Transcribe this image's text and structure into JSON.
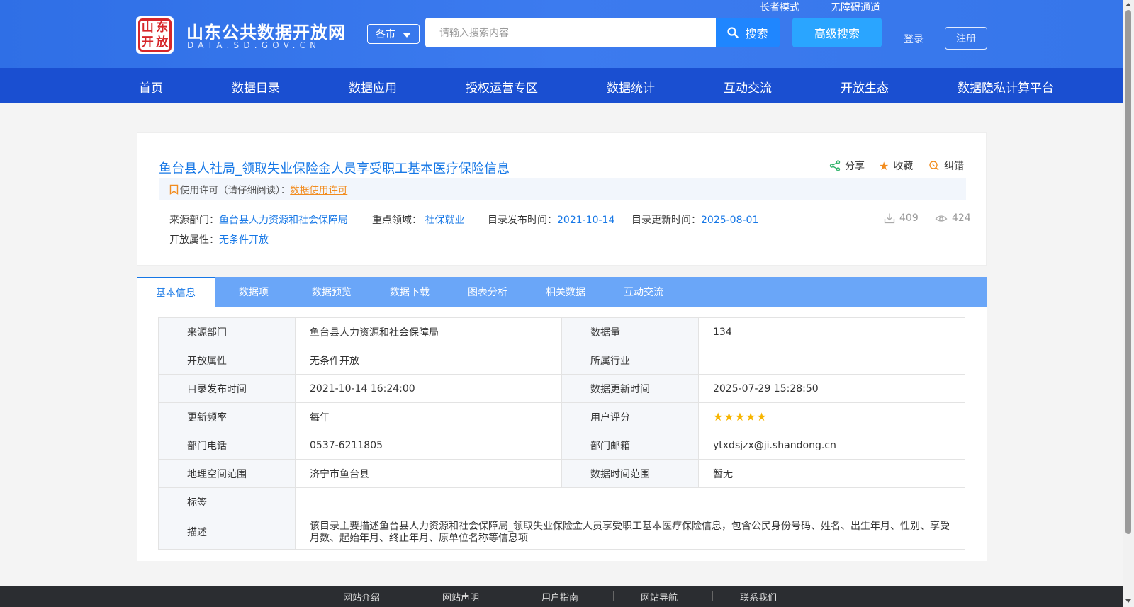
{
  "header": {
    "site_title": "山东公共数据开放网",
    "site_subtitle": "DATA.SD.GOV.CN",
    "seal_chars": [
      "山",
      "东",
      "开",
      "放"
    ],
    "city_select": "各市",
    "search_placeholder": "请输入搜索内容",
    "search_button": "搜索",
    "advanced_search": "高级搜索",
    "elder_mode": "长者模式",
    "accessibility": "无障碍通道",
    "login": "登录",
    "register": "注册"
  },
  "nav": [
    "首页",
    "数据目录",
    "数据应用",
    "授权运营专区",
    "数据统计",
    "互动交流",
    "开放生态",
    "数据隐私计算平台"
  ],
  "dataset": {
    "title": "鱼台县人社局_领取失业保险金人员享受职工基本医疗保险信息",
    "actions": {
      "share": "分享",
      "favorite": "收藏",
      "correct": "纠错"
    },
    "license_label": "使用许可（请仔细阅读）：",
    "license_link": "数据使用许可",
    "meta": {
      "source_label": "来源部门：",
      "source": "鱼台县人力资源和社会保障局",
      "domain_label": "重点领域：",
      "domain": "社保就业",
      "published_label": "目录发布时间：",
      "published": "2021-10-14",
      "updated_label": "目录更新时间：",
      "updated": "2025-08-01",
      "open_label": "开放属性：",
      "open": "无条件开放"
    },
    "downloads": "409",
    "views": "424"
  },
  "tabs": [
    "基本信息",
    "数据项",
    "数据预览",
    "数据下载",
    "图表分析",
    "相关数据",
    "互动交流"
  ],
  "info": {
    "r1": {
      "l1": "来源部门",
      "v1": "鱼台县人力资源和社会保障局",
      "l2": "数据量",
      "v2": "134"
    },
    "r2": {
      "l1": "开放属性",
      "v1": "无条件开放",
      "l2": "所属行业",
      "v2": ""
    },
    "r3": {
      "l1": "目录发布时间",
      "v1": "2021-10-14 16:24:00",
      "l2": "数据更新时间",
      "v2": "2025-07-29 15:28:50"
    },
    "r4": {
      "l1": "更新频率",
      "v1": "每年",
      "l2": "用户评分",
      "rating": 5
    },
    "r5": {
      "l1": "部门电话",
      "v1": "0537-6211805",
      "l2": "部门邮箱",
      "v2": "ytxdsjzx@ji.shandong.cn"
    },
    "r6": {
      "l1": "地理空间范围",
      "v1": "济宁市鱼台县",
      "l2": "数据时间范围",
      "v2": "暂无"
    },
    "r7": {
      "l1": "标签",
      "v1": ""
    },
    "r8": {
      "l1": "描述",
      "v1": "该目录主要描述鱼台县人力资源和社会保障局_领取失业保险金人员享受职工基本医疗保险信息，包含公民身份号码、姓名、出生年月、性别、享受月数、起始年月、终止年月、原单位名称等信息项"
    }
  },
  "footer": [
    "网站介绍",
    "网站声明",
    "用户指南",
    "网站导航",
    "联系我们"
  ],
  "colors": {
    "primary": "#1677e6",
    "nav_bg": "#1a4fd1",
    "tab_bg": "#6aa6f8",
    "accent_orange": "#f28c1e"
  }
}
